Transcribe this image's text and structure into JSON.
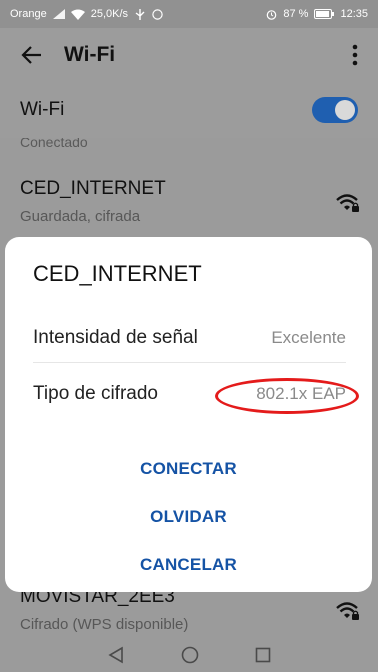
{
  "status_bar": {
    "carrier": "Orange",
    "network_speed": "25,0K/s",
    "battery": "87 %",
    "time": "12:35"
  },
  "app_bar": {
    "title": "Wi-Fi"
  },
  "wifi_toggle": {
    "label": "Wi-Fi",
    "enabled": true,
    "color_on": "#1f5fb0"
  },
  "networks": [
    {
      "ssid": "",
      "status": "Conectado"
    },
    {
      "ssid": "CED_INTERNET",
      "status": "Guardada, cifrada"
    },
    {
      "ssid": "MOVISTAR_2EE3",
      "status": "Cifrado (WPS disponible)"
    }
  ],
  "dialog": {
    "title": "CED_INTERNET",
    "rows": [
      {
        "label": "Intensidad de señal",
        "value": "Excelente"
      },
      {
        "label": "Tipo de cifrado",
        "value": "802.1x EAP"
      }
    ],
    "buttons": {
      "connect": "CONECTAR",
      "forget": "OLVIDAR",
      "cancel": "CANCELAR"
    },
    "accent_color": "#1553a5",
    "highlight_color": "#e41b1b"
  },
  "icons": [
    "back-arrow-icon",
    "more-vert-icon",
    "wifi-lock-icon",
    "nav-back-icon",
    "nav-home-icon",
    "nav-recents-icon"
  ]
}
